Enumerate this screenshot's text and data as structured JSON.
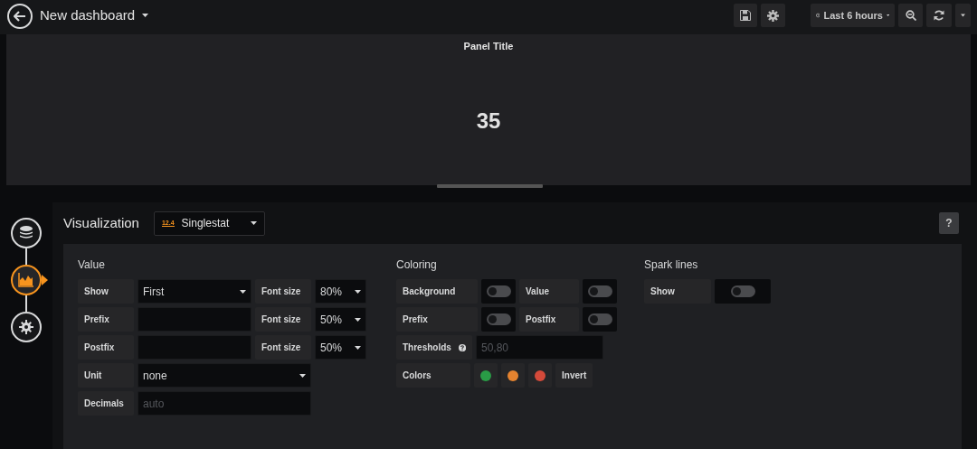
{
  "header": {
    "title": "New dashboard"
  },
  "toolbar": {
    "time_range": "Last 6 hours"
  },
  "panel": {
    "title": "Panel Title",
    "value": "35"
  },
  "editor": {
    "title": "Visualization",
    "picker": {
      "icon_text": "12.4",
      "label": "Singlestat"
    },
    "help": "?",
    "steps": [
      {
        "kind": "queries",
        "selected": false
      },
      {
        "kind": "visualization",
        "selected": true
      },
      {
        "kind": "general",
        "selected": false
      }
    ]
  },
  "value_section": {
    "title": "Value",
    "rows": [
      {
        "label": "Show",
        "kind": "select",
        "value": "First",
        "font_size": {
          "label": "Font size",
          "value": "80%"
        }
      },
      {
        "label": "Prefix",
        "kind": "input",
        "font_size": {
          "label": "Font size",
          "value": "50%"
        }
      },
      {
        "label": "Postfix",
        "kind": "input",
        "font_size": {
          "label": "Font size",
          "value": "50%"
        }
      },
      {
        "label": "Unit",
        "kind": "select",
        "value": "none"
      },
      {
        "label": "Decimals",
        "kind": "input",
        "placeholder": "auto"
      }
    ]
  },
  "coloring": {
    "title": "Coloring",
    "toggle_rows": [
      [
        {
          "label": "Background",
          "on": false
        },
        {
          "label": "Value",
          "on": false
        }
      ],
      [
        {
          "label": "Prefix",
          "on": false
        },
        {
          "label": "Postfix",
          "on": false
        }
      ]
    ],
    "thresholds": {
      "label": "Thresholds",
      "placeholder": "50,80"
    },
    "colors": {
      "label": "Colors",
      "swatches": [
        {
          "color": "#299c46"
        },
        {
          "color": "#e5832f"
        },
        {
          "color": "#d44a3a"
        }
      ],
      "invert": "Invert"
    }
  },
  "spark_lines": {
    "title": "Spark lines",
    "toggles": [
      {
        "label": "Show",
        "on": false
      }
    ]
  }
}
